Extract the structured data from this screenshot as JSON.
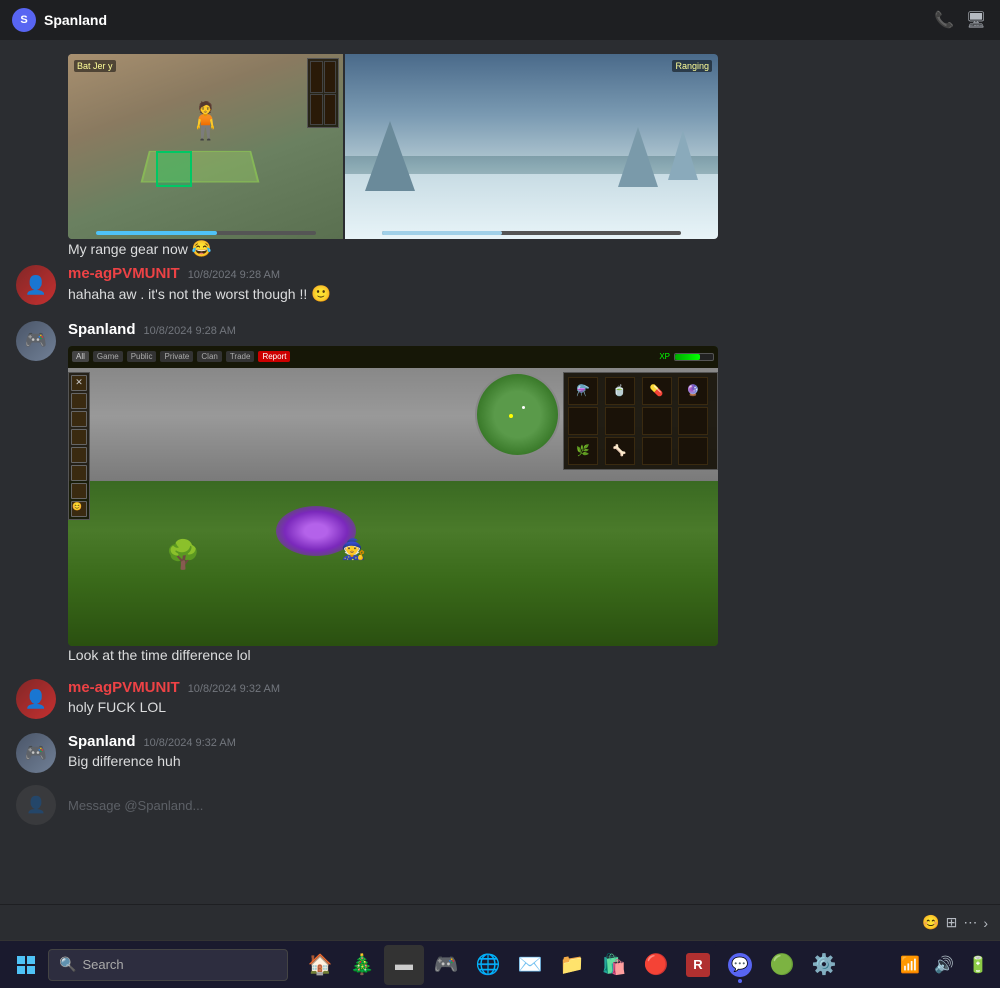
{
  "titleBar": {
    "channelName": "Spanland",
    "callIcon": "📞",
    "screenIcon": "🖥"
  },
  "messages": [
    {
      "id": "msg1",
      "type": "continuation",
      "text": "My range gear now 😂",
      "hasImage": true,
      "imageType": "double"
    },
    {
      "id": "msg2",
      "username": "me-agPVMUNIT",
      "usernameClass": "username-me",
      "timestamp": "10/8/2024 9:28 AM",
      "text": "hahaha aw . it's not the worst though !! 🙂"
    },
    {
      "id": "msg3",
      "username": "Spanland",
      "usernameClass": "username-spanland",
      "timestamp": "10/8/2024 9:28 AM",
      "text": "Look at the time difference lol",
      "hasImage": true,
      "imageType": "single"
    },
    {
      "id": "msg4",
      "username": "me-agPVMUNIT",
      "usernameClass": "username-me",
      "timestamp": "10/8/2024 9:32 AM",
      "text": "holy FUCK LOL"
    },
    {
      "id": "msg5",
      "username": "Spanland",
      "usernameClass": "username-spanland",
      "timestamp": "10/8/2024 9:32 AM",
      "text": "Big difference huh"
    },
    {
      "id": "msg6",
      "username": "Message @Spanland",
      "usernameClass": "username-spanland",
      "timestamp": "",
      "text": "",
      "isPartial": true
    }
  ],
  "taskbar": {
    "searchPlaceholder": "Search",
    "apps": [
      {
        "icon": "🪟",
        "label": "Windows Start",
        "active": false
      },
      {
        "icon": "🏠",
        "label": "Home",
        "active": false
      },
      {
        "icon": "🎄",
        "label": "Seasonal",
        "active": false
      },
      {
        "icon": "⬛",
        "label": "Files",
        "active": false
      },
      {
        "icon": "🎮",
        "label": "Gaming",
        "active": false
      },
      {
        "icon": "🌐",
        "label": "Edge",
        "active": false
      },
      {
        "icon": "✉️",
        "label": "Mail",
        "active": false
      },
      {
        "icon": "📁",
        "label": "Explorer",
        "active": false
      },
      {
        "icon": "📦",
        "label": "Store",
        "active": false
      },
      {
        "icon": "🔴",
        "label": "Chrome",
        "active": false
      },
      {
        "icon": "🎲",
        "label": "Game App",
        "active": false
      },
      {
        "icon": "💬",
        "label": "Discord",
        "active": true
      },
      {
        "icon": "🟢",
        "label": "Spotify",
        "active": false
      },
      {
        "icon": "⚙️",
        "label": "Settings",
        "active": false
      }
    ]
  }
}
